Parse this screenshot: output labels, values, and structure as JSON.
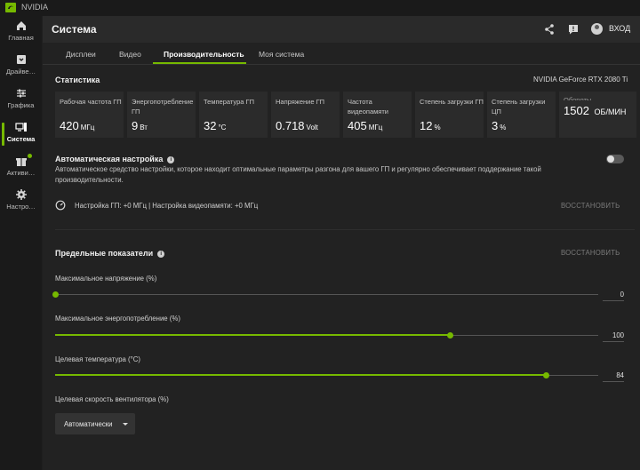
{
  "app": {
    "name": "NVIDIA"
  },
  "nav": {
    "items": [
      {
        "id": "home",
        "label": "Главная",
        "icon": "home-icon"
      },
      {
        "id": "drivers",
        "label": "Драйве…",
        "icon": "driver-icon"
      },
      {
        "id": "graphics",
        "label": "Графика",
        "icon": "sliders-icon"
      },
      {
        "id": "system",
        "label": "Система",
        "icon": "system-icon",
        "active": true
      },
      {
        "id": "activity",
        "label": "Активи…",
        "icon": "gift-icon",
        "badge": true
      },
      {
        "id": "settings",
        "label": "Настро…",
        "icon": "gear-icon"
      }
    ]
  },
  "header": {
    "title": "Система",
    "login_label": "ВХОД"
  },
  "tabs": [
    "Дисплеи",
    "Видео",
    "Производительность",
    "Моя система"
  ],
  "stats": {
    "title": "Статистика",
    "gpu_name": "NVIDIA GeForce RTX 2080 Ti",
    "cards": [
      {
        "caption": "Рабочая частота ГП",
        "value": "420",
        "unit": "МГц"
      },
      {
        "caption": "Энергопотребление ГП",
        "value": "9",
        "unit": "Вт"
      },
      {
        "caption": "Температура ГП",
        "value": "32",
        "unit": "°C"
      },
      {
        "caption": "Напряжение ГП",
        "value": "0.718",
        "unit": "Volt"
      },
      {
        "caption": "Частота видеопамяти",
        "value": "405",
        "unit": "МГц"
      },
      {
        "caption": "Степень загрузки ГП",
        "value": "12",
        "unit": "%"
      },
      {
        "caption": "Степень загрузки ЦП",
        "value": "3",
        "unit": "%"
      },
      {
        "caption": "Обороты…",
        "value": "1502",
        "unit": "ОБ/МИН"
      }
    ]
  },
  "auto_tune": {
    "title": "Автоматическая настройка",
    "description": "Автоматическое средство настройки, которое находит оптимальные параметры разгона для вашего ГП и регулярно обеспечивает поддержание такой производительности.",
    "toggle_on": false,
    "status_text": "Настройка ГП: +0 МГц   |   Настройка видеопамяти: +0 МГц",
    "restore_label": "ВОССТАНОВИТЬ"
  },
  "limits": {
    "title": "Предельные показатели",
    "restore_label": "ВОССТАНОВИТЬ",
    "sliders": [
      {
        "label": "Максимальное напряжение (%)",
        "value": "0",
        "fraction": 0.0
      },
      {
        "label": "Максимальное энергопотребление (%)",
        "value": "100",
        "fraction": 0.726
      },
      {
        "label": "Целевая температура (°C)",
        "value": "84",
        "fraction": 0.904
      }
    ],
    "fan": {
      "label": "Целевая скорость вентилятора (%)",
      "selected": "Автоматически"
    }
  },
  "colors": {
    "accent": "#76b900"
  }
}
